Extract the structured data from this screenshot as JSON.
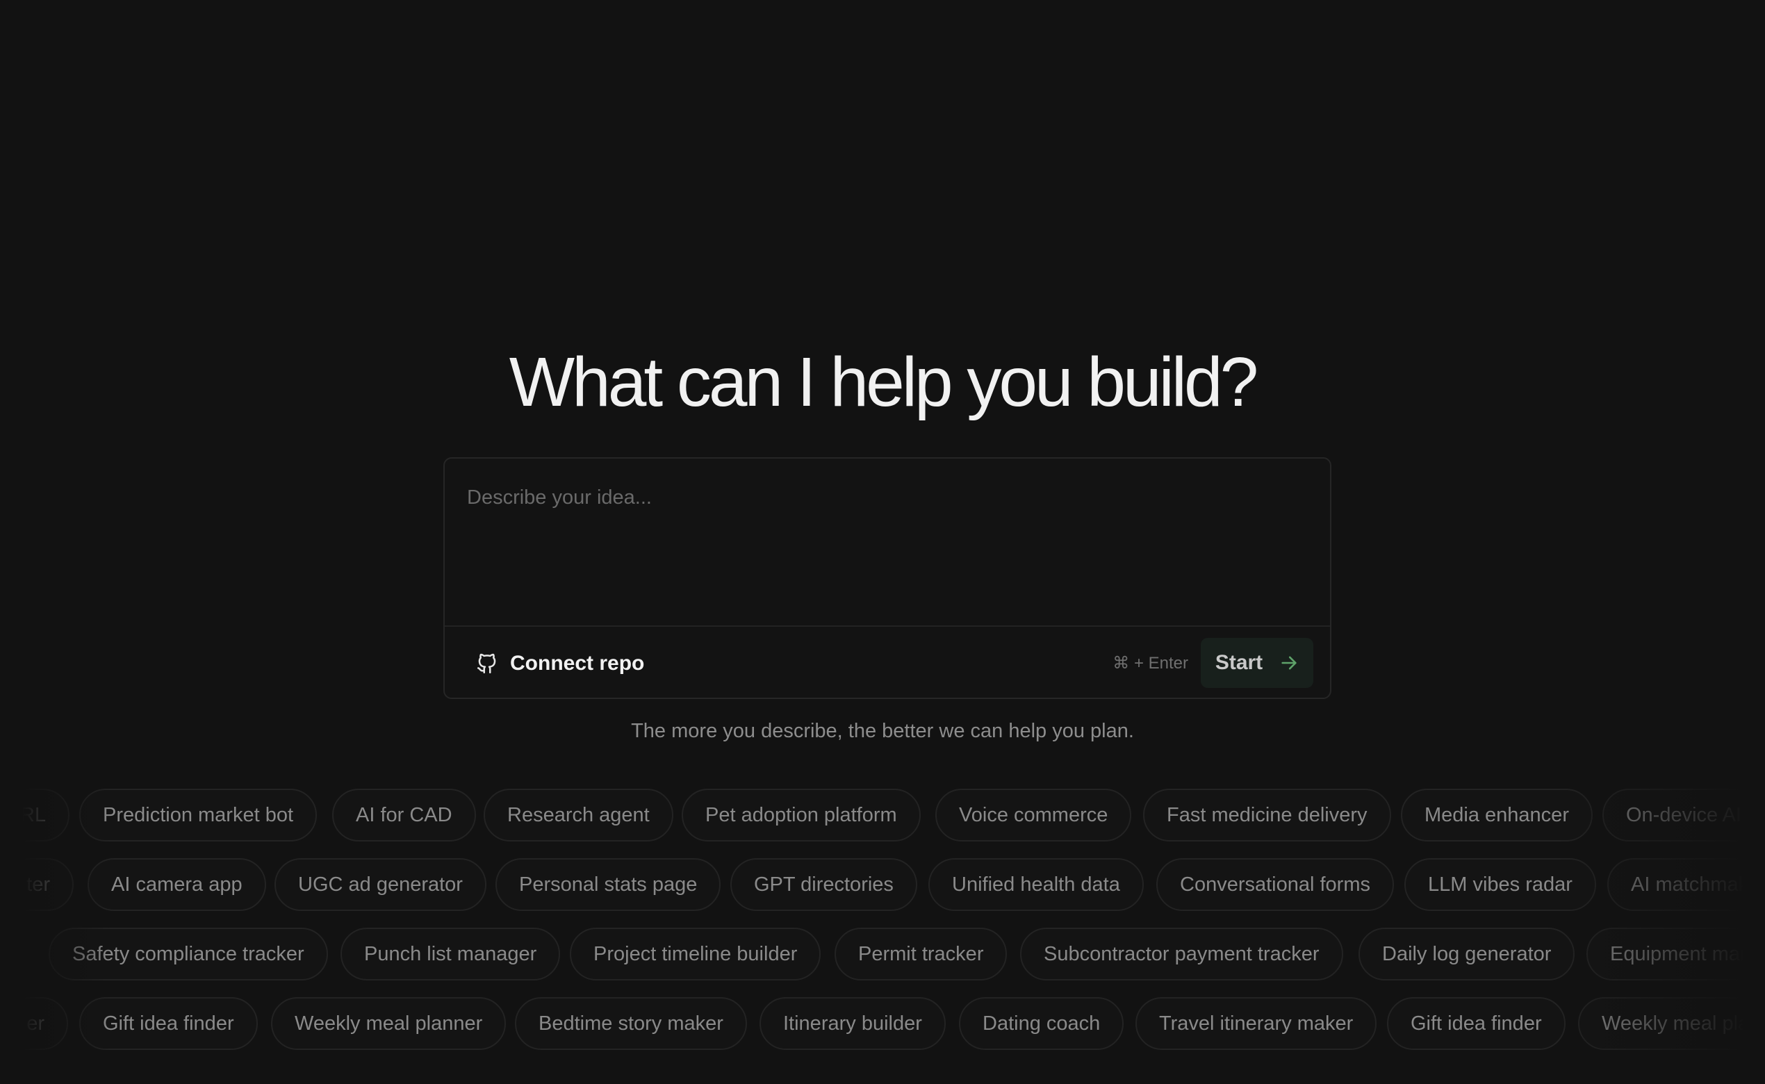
{
  "hero": {
    "title": "What can I help you build?"
  },
  "composer": {
    "placeholder": "Describe your idea...",
    "value": "",
    "connect_repo_label": "Connect repo",
    "shortcut_hint": "⌘ + Enter",
    "start_label": "Start",
    "accent_color": "#5fa36a"
  },
  "helper_text": "The more you describe, the better we can help you plan.",
  "suggestion_rows": [
    {
      "partial_left": "RL",
      "items": [
        "Prediction market bot",
        "AI for CAD",
        "Research agent",
        "Pet adoption platform",
        "Voice commerce",
        "Fast medicine delivery",
        "Media enhancer"
      ],
      "partial_right": "On-device AI"
    },
    {
      "partial_left": "ter",
      "items": [
        "AI camera app",
        "UGC ad generator",
        "Personal stats page",
        "GPT directories",
        "Unified health data",
        "Conversational forms",
        "LLM vibes radar"
      ],
      "partial_right": "AI matchmaker"
    },
    {
      "partial_left": "",
      "items": [
        "Safety compliance tracker",
        "Punch list manager",
        "Project timeline builder",
        "Permit tracker",
        "Subcontractor payment tracker",
        "Daily log generator"
      ],
      "partial_right": "Equipment manager"
    },
    {
      "partial_left": "er",
      "items": [
        "Gift idea finder",
        "Weekly meal planner",
        "Bedtime story maker",
        "Itinerary builder",
        "Dating coach",
        "Travel itinerary maker",
        "Gift idea finder"
      ],
      "partial_right": "Weekly meal planner"
    }
  ]
}
